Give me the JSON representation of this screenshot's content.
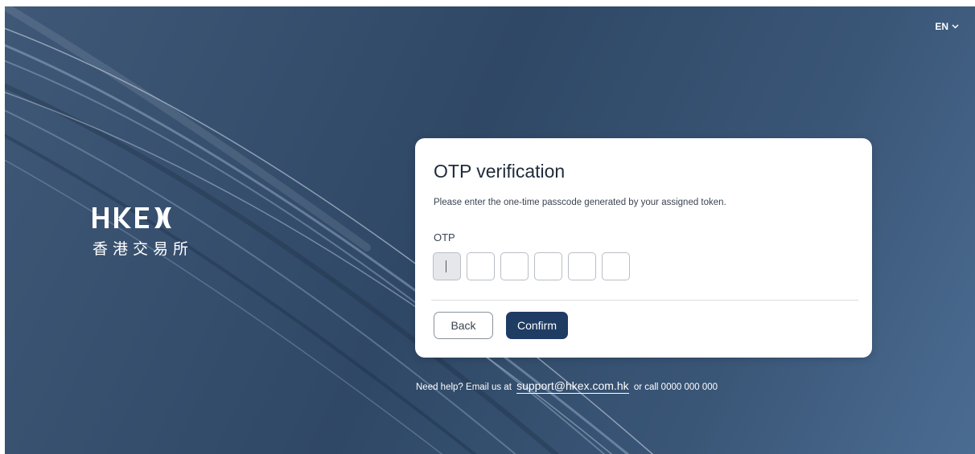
{
  "header": {
    "language_label": "EN"
  },
  "brand": {
    "logo_text": "HKEX",
    "logo_subtext": "香港交易所"
  },
  "otp_card": {
    "title": "OTP verification",
    "description": "Please enter the one-time passcode generated by your assigned token.",
    "field_label": "OTP",
    "digit_values": [
      "",
      "",
      "",
      "",
      "",
      ""
    ],
    "back_label": "Back",
    "confirm_label": "Confirm"
  },
  "footer": {
    "help_prefix": "Need help? Email us at",
    "support_email": "support@hkex.com.hk",
    "help_suffix": "or call 0000 000 000"
  },
  "colors": {
    "background": "#2f4866",
    "primary_button": "#1f3c63",
    "card": "#ffffff"
  }
}
